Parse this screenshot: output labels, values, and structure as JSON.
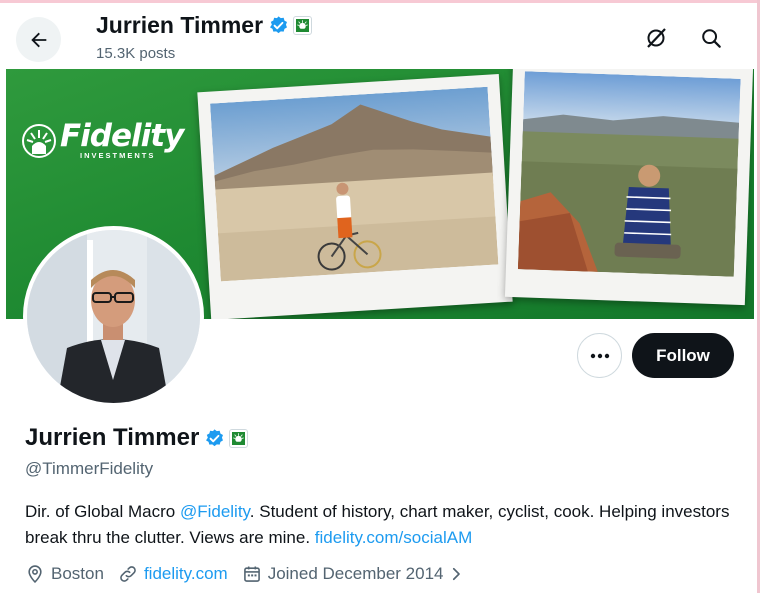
{
  "header": {
    "name": "Jurrien Timmer",
    "posts": "15.3K posts"
  },
  "banner": {
    "logo_word": "Fidelity",
    "logo_sub": "INVESTMENTS"
  },
  "actions": {
    "follow_label": "Follow",
    "more_label": "•••"
  },
  "profile": {
    "name": "Jurrien Timmer",
    "handle": "@TimmerFidelity",
    "bio_part1": "Dir. of Global Macro ",
    "bio_mention": "@Fidelity",
    "bio_part2": ". Student of history, chart maker, cyclist, cook. Helping investors break thru the clutter. Views are mine. ",
    "bio_link": "fidelity.com/socialAM",
    "location": "Boston",
    "website": "fidelity.com",
    "joined": "Joined December 2014"
  },
  "colors": {
    "accent": "#1d9bf0",
    "verified": "#1d9bf0",
    "banner_green": "#1f8a32",
    "follow_bg": "#0f1419"
  },
  "icons": [
    "back-arrow-icon",
    "verified-badge-icon",
    "affiliate-badge-icon",
    "grok-icon",
    "search-icon",
    "more-icon",
    "location-icon",
    "link-icon",
    "calendar-icon",
    "chevron-right-icon"
  ]
}
